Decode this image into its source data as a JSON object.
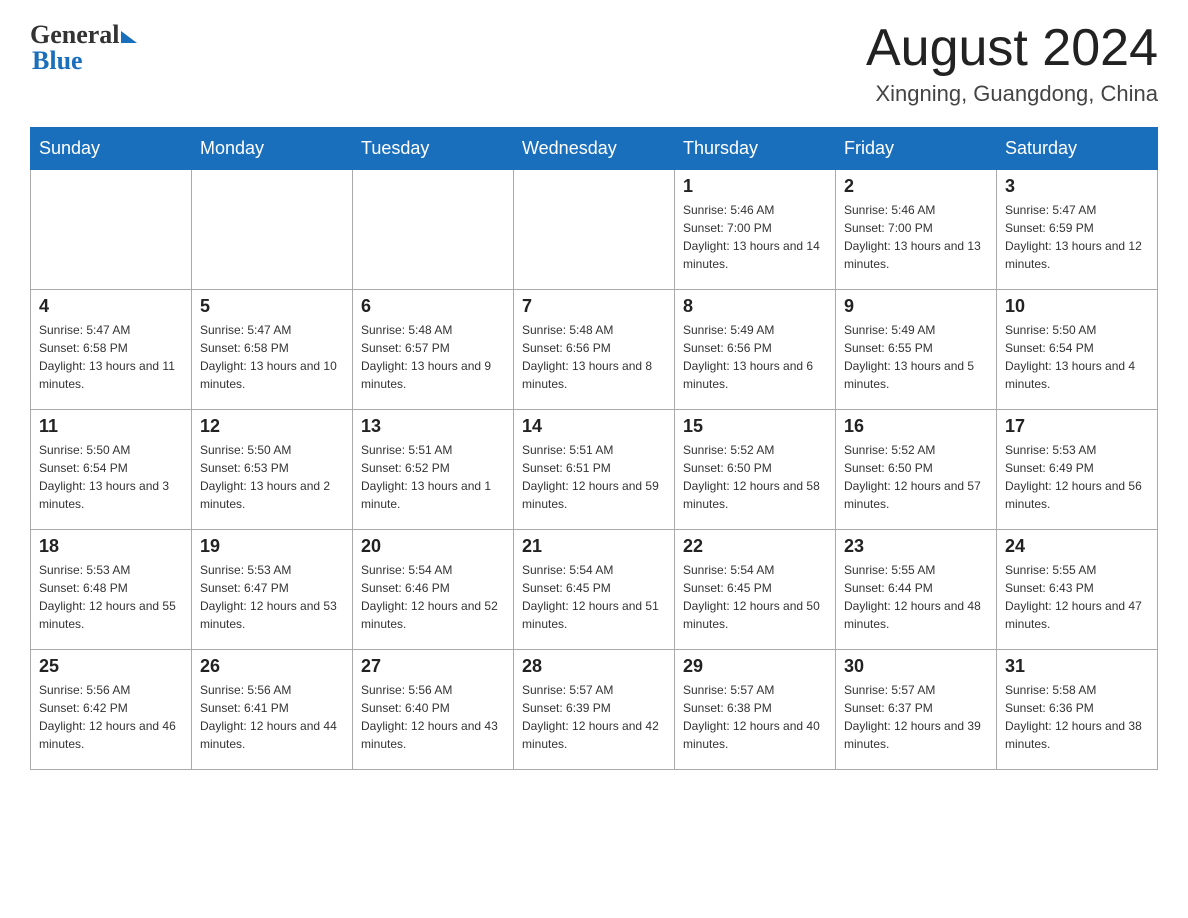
{
  "header": {
    "month_title": "August 2024",
    "location": "Xingning, Guangdong, China",
    "logo_general": "General",
    "logo_blue": "Blue"
  },
  "days_of_week": [
    "Sunday",
    "Monday",
    "Tuesday",
    "Wednesday",
    "Thursday",
    "Friday",
    "Saturday"
  ],
  "weeks": [
    [
      {
        "day": "",
        "sunrise": "",
        "sunset": "",
        "daylight": ""
      },
      {
        "day": "",
        "sunrise": "",
        "sunset": "",
        "daylight": ""
      },
      {
        "day": "",
        "sunrise": "",
        "sunset": "",
        "daylight": ""
      },
      {
        "day": "",
        "sunrise": "",
        "sunset": "",
        "daylight": ""
      },
      {
        "day": "1",
        "sunrise": "Sunrise: 5:46 AM",
        "sunset": "Sunset: 7:00 PM",
        "daylight": "Daylight: 13 hours and 14 minutes."
      },
      {
        "day": "2",
        "sunrise": "Sunrise: 5:46 AM",
        "sunset": "Sunset: 7:00 PM",
        "daylight": "Daylight: 13 hours and 13 minutes."
      },
      {
        "day": "3",
        "sunrise": "Sunrise: 5:47 AM",
        "sunset": "Sunset: 6:59 PM",
        "daylight": "Daylight: 13 hours and 12 minutes."
      }
    ],
    [
      {
        "day": "4",
        "sunrise": "Sunrise: 5:47 AM",
        "sunset": "Sunset: 6:58 PM",
        "daylight": "Daylight: 13 hours and 11 minutes."
      },
      {
        "day": "5",
        "sunrise": "Sunrise: 5:47 AM",
        "sunset": "Sunset: 6:58 PM",
        "daylight": "Daylight: 13 hours and 10 minutes."
      },
      {
        "day": "6",
        "sunrise": "Sunrise: 5:48 AM",
        "sunset": "Sunset: 6:57 PM",
        "daylight": "Daylight: 13 hours and 9 minutes."
      },
      {
        "day": "7",
        "sunrise": "Sunrise: 5:48 AM",
        "sunset": "Sunset: 6:56 PM",
        "daylight": "Daylight: 13 hours and 8 minutes."
      },
      {
        "day": "8",
        "sunrise": "Sunrise: 5:49 AM",
        "sunset": "Sunset: 6:56 PM",
        "daylight": "Daylight: 13 hours and 6 minutes."
      },
      {
        "day": "9",
        "sunrise": "Sunrise: 5:49 AM",
        "sunset": "Sunset: 6:55 PM",
        "daylight": "Daylight: 13 hours and 5 minutes."
      },
      {
        "day": "10",
        "sunrise": "Sunrise: 5:50 AM",
        "sunset": "Sunset: 6:54 PM",
        "daylight": "Daylight: 13 hours and 4 minutes."
      }
    ],
    [
      {
        "day": "11",
        "sunrise": "Sunrise: 5:50 AM",
        "sunset": "Sunset: 6:54 PM",
        "daylight": "Daylight: 13 hours and 3 minutes."
      },
      {
        "day": "12",
        "sunrise": "Sunrise: 5:50 AM",
        "sunset": "Sunset: 6:53 PM",
        "daylight": "Daylight: 13 hours and 2 minutes."
      },
      {
        "day": "13",
        "sunrise": "Sunrise: 5:51 AM",
        "sunset": "Sunset: 6:52 PM",
        "daylight": "Daylight: 13 hours and 1 minute."
      },
      {
        "day": "14",
        "sunrise": "Sunrise: 5:51 AM",
        "sunset": "Sunset: 6:51 PM",
        "daylight": "Daylight: 12 hours and 59 minutes."
      },
      {
        "day": "15",
        "sunrise": "Sunrise: 5:52 AM",
        "sunset": "Sunset: 6:50 PM",
        "daylight": "Daylight: 12 hours and 58 minutes."
      },
      {
        "day": "16",
        "sunrise": "Sunrise: 5:52 AM",
        "sunset": "Sunset: 6:50 PM",
        "daylight": "Daylight: 12 hours and 57 minutes."
      },
      {
        "day": "17",
        "sunrise": "Sunrise: 5:53 AM",
        "sunset": "Sunset: 6:49 PM",
        "daylight": "Daylight: 12 hours and 56 minutes."
      }
    ],
    [
      {
        "day": "18",
        "sunrise": "Sunrise: 5:53 AM",
        "sunset": "Sunset: 6:48 PM",
        "daylight": "Daylight: 12 hours and 55 minutes."
      },
      {
        "day": "19",
        "sunrise": "Sunrise: 5:53 AM",
        "sunset": "Sunset: 6:47 PM",
        "daylight": "Daylight: 12 hours and 53 minutes."
      },
      {
        "day": "20",
        "sunrise": "Sunrise: 5:54 AM",
        "sunset": "Sunset: 6:46 PM",
        "daylight": "Daylight: 12 hours and 52 minutes."
      },
      {
        "day": "21",
        "sunrise": "Sunrise: 5:54 AM",
        "sunset": "Sunset: 6:45 PM",
        "daylight": "Daylight: 12 hours and 51 minutes."
      },
      {
        "day": "22",
        "sunrise": "Sunrise: 5:54 AM",
        "sunset": "Sunset: 6:45 PM",
        "daylight": "Daylight: 12 hours and 50 minutes."
      },
      {
        "day": "23",
        "sunrise": "Sunrise: 5:55 AM",
        "sunset": "Sunset: 6:44 PM",
        "daylight": "Daylight: 12 hours and 48 minutes."
      },
      {
        "day": "24",
        "sunrise": "Sunrise: 5:55 AM",
        "sunset": "Sunset: 6:43 PM",
        "daylight": "Daylight: 12 hours and 47 minutes."
      }
    ],
    [
      {
        "day": "25",
        "sunrise": "Sunrise: 5:56 AM",
        "sunset": "Sunset: 6:42 PM",
        "daylight": "Daylight: 12 hours and 46 minutes."
      },
      {
        "day": "26",
        "sunrise": "Sunrise: 5:56 AM",
        "sunset": "Sunset: 6:41 PM",
        "daylight": "Daylight: 12 hours and 44 minutes."
      },
      {
        "day": "27",
        "sunrise": "Sunrise: 5:56 AM",
        "sunset": "Sunset: 6:40 PM",
        "daylight": "Daylight: 12 hours and 43 minutes."
      },
      {
        "day": "28",
        "sunrise": "Sunrise: 5:57 AM",
        "sunset": "Sunset: 6:39 PM",
        "daylight": "Daylight: 12 hours and 42 minutes."
      },
      {
        "day": "29",
        "sunrise": "Sunrise: 5:57 AM",
        "sunset": "Sunset: 6:38 PM",
        "daylight": "Daylight: 12 hours and 40 minutes."
      },
      {
        "day": "30",
        "sunrise": "Sunrise: 5:57 AM",
        "sunset": "Sunset: 6:37 PM",
        "daylight": "Daylight: 12 hours and 39 minutes."
      },
      {
        "day": "31",
        "sunrise": "Sunrise: 5:58 AM",
        "sunset": "Sunset: 6:36 PM",
        "daylight": "Daylight: 12 hours and 38 minutes."
      }
    ]
  ]
}
